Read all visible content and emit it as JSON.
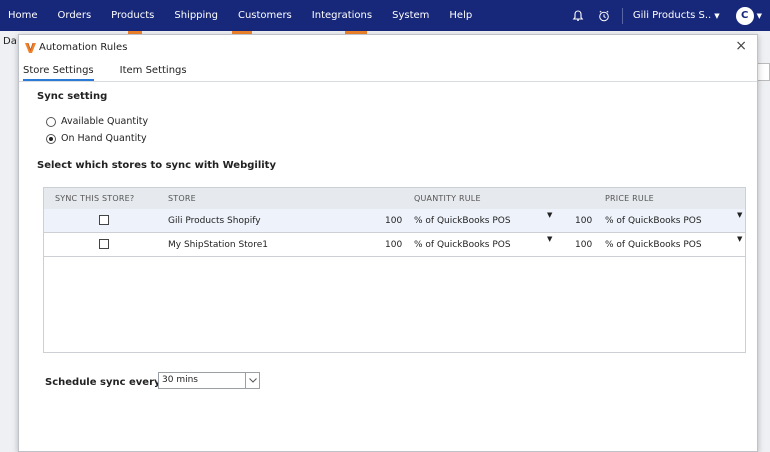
{
  "nav": {
    "items": [
      "Home",
      "Orders",
      "Products",
      "Shipping",
      "Customers",
      "Integrations",
      "System",
      "Help"
    ],
    "company": "Gili Products S..",
    "avatar_initial": "C",
    "icons": [
      "bell-icon",
      "clock-icon"
    ],
    "background_color": "#17287b",
    "accent_color": "#f0832a"
  },
  "background_page": {
    "tab_fragment": "Da"
  },
  "modal": {
    "title": "Automation Rules",
    "close": "×",
    "tabs": [
      {
        "label": "Store Settings",
        "active": true
      },
      {
        "label": "Item Settings",
        "active": false
      }
    ],
    "sync_setting": {
      "title": "Sync setting",
      "options": [
        {
          "label": "Available Quantity",
          "selected": false
        },
        {
          "label": "On Hand Quantity",
          "selected": true
        }
      ]
    },
    "stores_section_title": "Select which stores to sync with Webgility",
    "table": {
      "headers": [
        "SYNC THIS STORE?",
        "STORE",
        "QUANTITY RULE",
        "PRICE RULE"
      ],
      "rows": [
        {
          "sync": false,
          "store": "Gili Products Shopify",
          "qty_value": "100",
          "qty_rule": "% of QuickBooks POS",
          "price_value": "100",
          "price_rule": "% of QuickBooks POS",
          "highlighted": true
        },
        {
          "sync": false,
          "store": "My ShipStation Store1",
          "qty_value": "100",
          "qty_rule": "% of QuickBooks POS",
          "price_value": "100",
          "price_rule": "% of QuickBooks POS",
          "highlighted": false
        }
      ]
    },
    "schedule": {
      "label": "Schedule sync every:",
      "value": "30 mins"
    }
  }
}
